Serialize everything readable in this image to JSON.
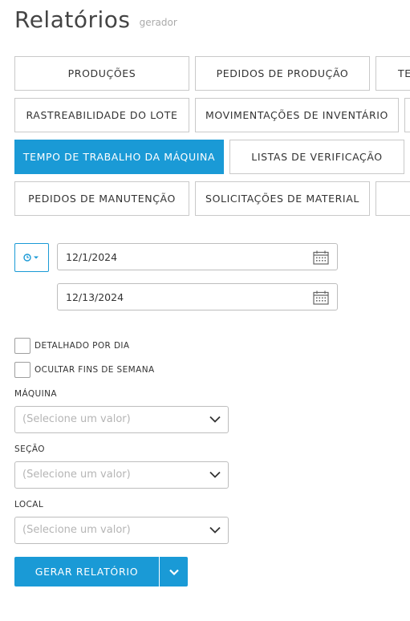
{
  "header": {
    "title": "Relatórios",
    "subtitle": "gerador"
  },
  "report_types": [
    {
      "label": "PRODUÇÕES",
      "active": false
    },
    {
      "label": "PEDIDOS DE PRODUÇÃO",
      "active": false
    },
    {
      "label": "TE",
      "active": false
    },
    {
      "label": "RASTREABILIDADE DO LOTE",
      "active": false
    },
    {
      "label": "MOVIMENTAÇÕES DE INVENTÁRIO",
      "active": false
    },
    {
      "label": "TEMPO DE TRABALHO DA MÁQUINA",
      "active": true
    },
    {
      "label": "LISTAS DE VERIFICAÇÃO",
      "active": false
    },
    {
      "label": "PEDIDOS DE MANUTENÇÃO",
      "active": false
    },
    {
      "label": "SOLICITAÇÕES DE MATERIAL",
      "active": false
    }
  ],
  "date_range": {
    "toggle_icon": "clock-icon",
    "start": "12/1/2024",
    "end": "12/13/2024"
  },
  "options": {
    "detailed_by_day": {
      "label": "DETALHADO POR DIA",
      "checked": false
    },
    "hide_weekends": {
      "label": "OCULTAR FINS DE SEMANA",
      "checked": false
    }
  },
  "filters": {
    "machine": {
      "label": "MÁQUINA",
      "placeholder": "(Selecione um valor)"
    },
    "section": {
      "label": "SEÇÃO",
      "placeholder": "(Selecione um valor)"
    },
    "location": {
      "label": "LOCAL",
      "placeholder": "(Selecione um valor)"
    }
  },
  "actions": {
    "generate_label": "GERAR RELATÓRIO"
  },
  "colors": {
    "accent": "#1a9ad6",
    "border": "#c9c9c9",
    "placeholder": "#b5b5b5"
  }
}
